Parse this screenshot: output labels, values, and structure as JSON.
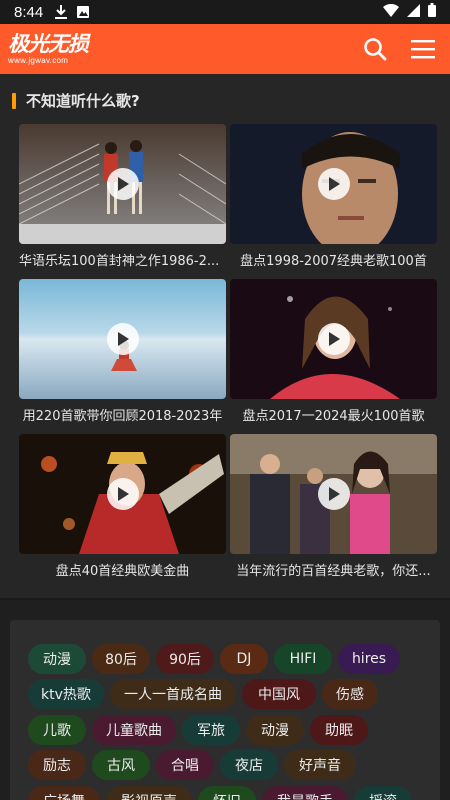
{
  "status_bar": {
    "time": "8:44",
    "icons": [
      "download-icon",
      "photo-icon",
      "wifi-icon",
      "signal-icon",
      "battery-icon"
    ]
  },
  "header": {
    "logo_cn": "极光无损",
    "logo_en": "www.jgwav.com",
    "icons": [
      "search-icon",
      "menu-icon"
    ],
    "background": "#ff5a2a"
  },
  "section": {
    "title": "不知道听什么歌?",
    "accent": "#ff9d00",
    "items": [
      {
        "title": "华语乐坛100首封神之作1986-2..."
      },
      {
        "title": "盘点1998-2007经典老歌100首"
      },
      {
        "title": "用220首歌带你回顾2018-2023年"
      },
      {
        "title": "盘点2017一2024最火100首歌"
      },
      {
        "title": "盘点40首经典欧美金曲"
      },
      {
        "title": "当年流行的百首经典老歌，你还..."
      }
    ]
  },
  "tags": [
    {
      "label": "动漫",
      "color": "#1d4a36"
    },
    {
      "label": "80后",
      "color": "#4a2a14"
    },
    {
      "label": "90后",
      "color": "#4e1a1a"
    },
    {
      "label": "DJ",
      "color": "#5a2a14"
    },
    {
      "label": "HIFI",
      "color": "#17452a"
    },
    {
      "label": "hires",
      "color": "#3a1a52"
    },
    {
      "label": "ktv热歌",
      "color": "#173c38"
    },
    {
      "label": "一人一首成名曲",
      "color": "#3e2c18"
    },
    {
      "label": "中国风",
      "color": "#4e1818"
    },
    {
      "label": "伤感",
      "color": "#4a2818"
    },
    {
      "label": "儿歌",
      "color": "#1e4a1e"
    },
    {
      "label": "儿童歌曲",
      "color": "#4a1a30"
    },
    {
      "label": "军旅",
      "color": "#173c38"
    },
    {
      "label": "动漫",
      "color": "#3e2c18"
    },
    {
      "label": "助眠",
      "color": "#4e1818"
    },
    {
      "label": "励志",
      "color": "#4a2818"
    },
    {
      "label": "古风",
      "color": "#1e4a1e"
    },
    {
      "label": "合唱",
      "color": "#4a1a30"
    },
    {
      "label": "夜店",
      "color": "#173c38"
    },
    {
      "label": "好声音",
      "color": "#3e2c18"
    },
    {
      "label": "广场舞",
      "color": "#4a2818"
    },
    {
      "label": "影视原声",
      "color": "#3e2c18"
    },
    {
      "label": "怀旧",
      "color": "#1e4a1e"
    },
    {
      "label": "我是歌手",
      "color": "#4a1a30"
    },
    {
      "label": "摇滚",
      "color": "#173c38"
    }
  ]
}
